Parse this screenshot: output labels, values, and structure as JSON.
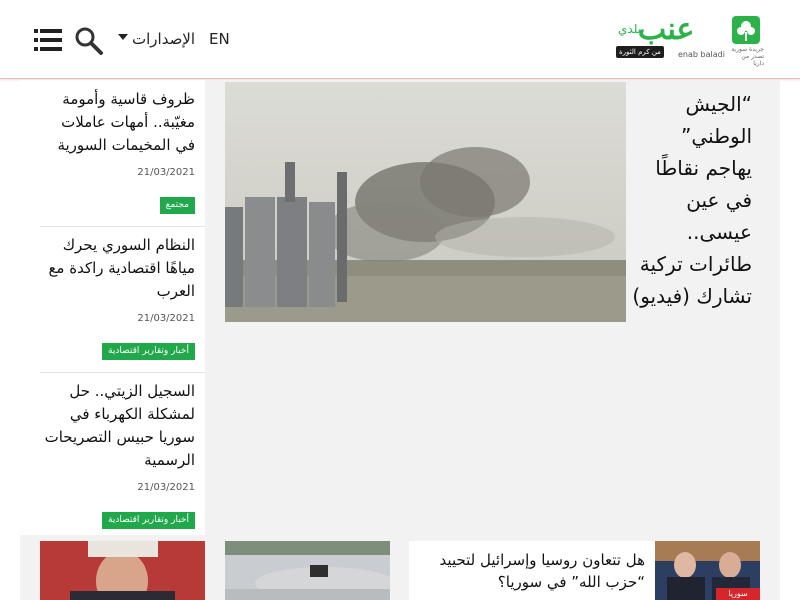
{
  "header": {
    "lang_label": "EN",
    "editions_label": "الإصدارات",
    "logo": {
      "word": "عنب",
      "small": "بلدي",
      "tag": "من كرم الثورة",
      "en": "enab baladi",
      "desc": "جريدة سورية تصدر من داريا"
    },
    "icons": [
      "menu-icon",
      "search-icon",
      "chevron-down-icon"
    ]
  },
  "hero": {
    "title": "“الجيش الوطني” يهاجم نقاطًا في عين عيسى.. طائرات تركية تشارك (فيديو)"
  },
  "sidebar": {
    "items": [
      {
        "title": "ظروف قاسية وأمومة مغيّبة.. أمهات عاملات في المخيمات السورية",
        "date": "21/03/2021",
        "tag": "مجتمع"
      },
      {
        "title": "النظام السوري يحرك مياهًا اقتصادية راكدة مع العرب",
        "date": "21/03/2021",
        "tag": "أخبار وتقارير اقتصادية"
      },
      {
        "title": "السجيل الزيتي.. حل لمشكلة الكهرباء في سوريا حبيس التصريحات الرسمية",
        "date": "21/03/2021",
        "tag": "أخبار وتقارير اقتصادية"
      }
    ]
  },
  "bottom": {
    "news_title": "هل تتعاون روسيا وإسرائيل لتحييد “حزب الله” في سوريا؟",
    "news_tag": "سوريا"
  },
  "colors": {
    "accent_green": "#21a84b",
    "header_border": "#e9b9b9",
    "tag_red": "#d7262b"
  }
}
